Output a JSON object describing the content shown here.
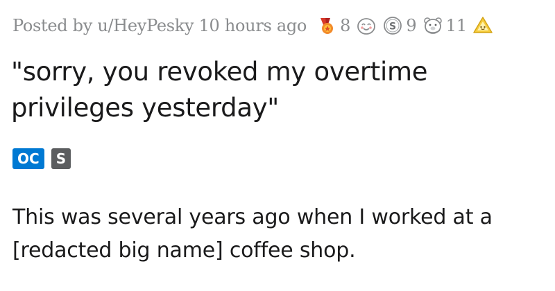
{
  "post": {
    "meta": {
      "posted_by": "Posted by u/HeyPesky 10 hours ago"
    },
    "awards": [
      {
        "icon": "medal-award-icon",
        "count": "8",
        "color": "#e0502a"
      },
      {
        "icon": "wholesome-face-award-icon",
        "count": "",
        "color": "#9a9a9a"
      },
      {
        "icon": "silver-coin-award-icon",
        "count": "9",
        "color": "#8a8c8e"
      },
      {
        "icon": "bear-hug-award-icon",
        "count": "11",
        "color": "#8a8c8e"
      },
      {
        "icon": "gold-helper-award-icon",
        "count": "",
        "color": "#f2c230"
      }
    ],
    "title": "\"sorry, you revoked my overtime privileges yesterday\"",
    "flairs": {
      "oc": "OC",
      "spoiler": "S"
    },
    "body": "This was several years ago when I worked at a [redacted big name] coffee shop."
  },
  "colors": {
    "meta_text": "#8a8c8e",
    "title_text": "#1a1a1b",
    "flair_oc_bg": "#0079d3",
    "flair_s_bg": "#5b5d5f"
  }
}
